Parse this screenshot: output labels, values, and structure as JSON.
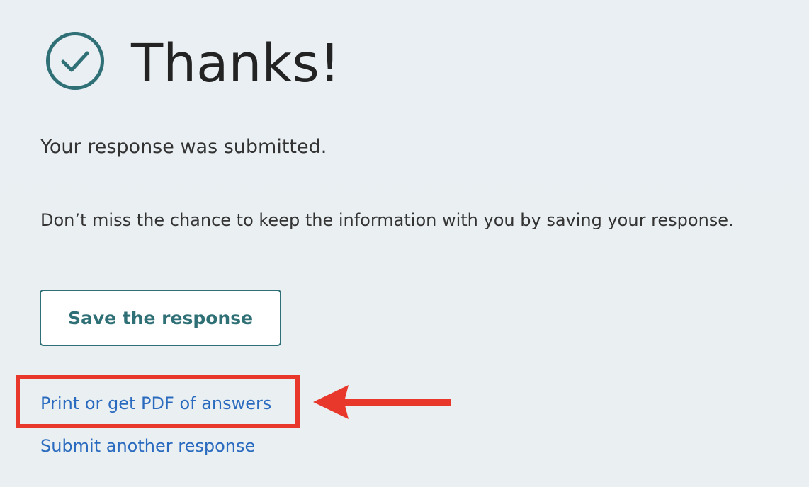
{
  "confirmation": {
    "title": "Thanks!",
    "submitted_message": "Your response was submitted.",
    "save_prompt": "Don’t miss the chance to keep the information with you by saving your response."
  },
  "actions": {
    "save_label": "Save the response",
    "print_link": "Print or get PDF of answers",
    "submit_another_link": "Submit another response"
  },
  "icons": {
    "status": "check-circle-icon",
    "annotation": "left-arrow-icon"
  },
  "colors": {
    "accent": "#2f7076",
    "link": "#2b6bbf",
    "annotation": "#e8382b",
    "background": "#eaf0f2"
  }
}
